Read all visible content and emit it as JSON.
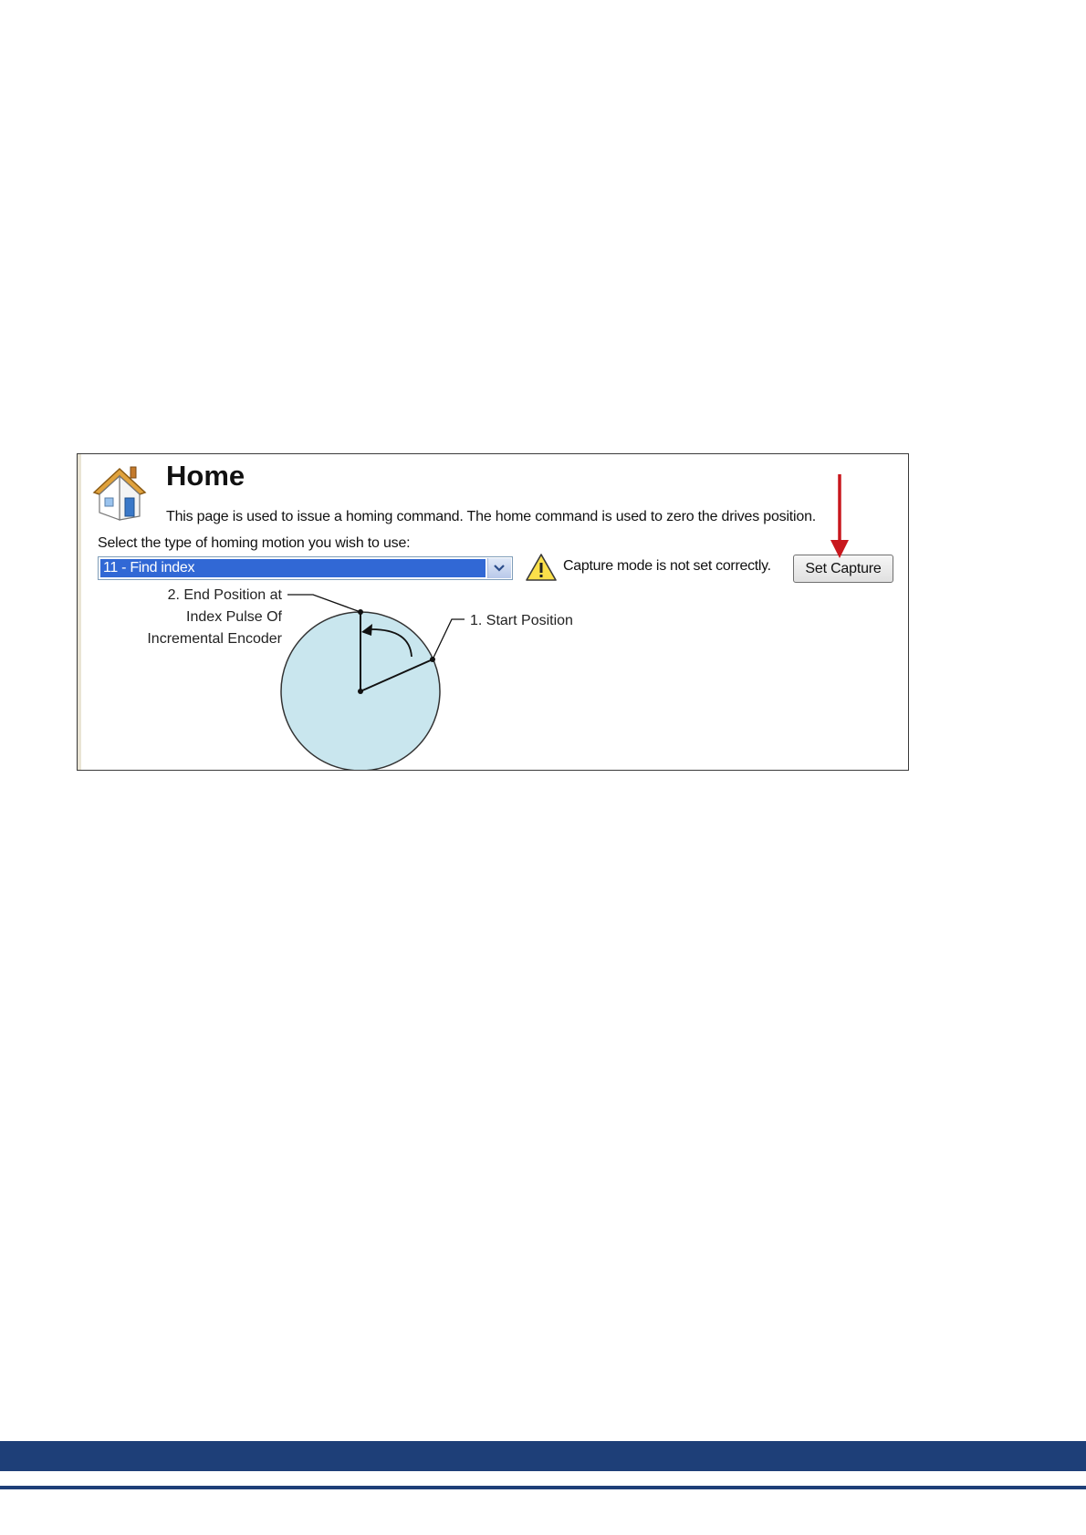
{
  "page": {
    "title": "Home",
    "description": "This page is used to issue a homing command. The home command is used to zero the drives position."
  },
  "homing": {
    "select_label": "Select the type of homing motion you wish to use:",
    "selected_option": "11 - Find index"
  },
  "warning": {
    "text": "Capture mode is not set correctly."
  },
  "buttons": {
    "set_capture": "Set Capture"
  },
  "diagram": {
    "end_position_label": [
      "2. End Position at",
      "Index Pulse Of",
      "Incremental Encoder"
    ],
    "start_position_label": "1. Start Position"
  },
  "colors": {
    "footer_bar": "#1e3f78",
    "selection": "#3168d5",
    "arrow": "#c8171d",
    "disc_fill": "#c9e6ee"
  },
  "icons": [
    "home-icon",
    "warning-icon",
    "chevron-down-icon",
    "red-arrow-icon"
  ]
}
